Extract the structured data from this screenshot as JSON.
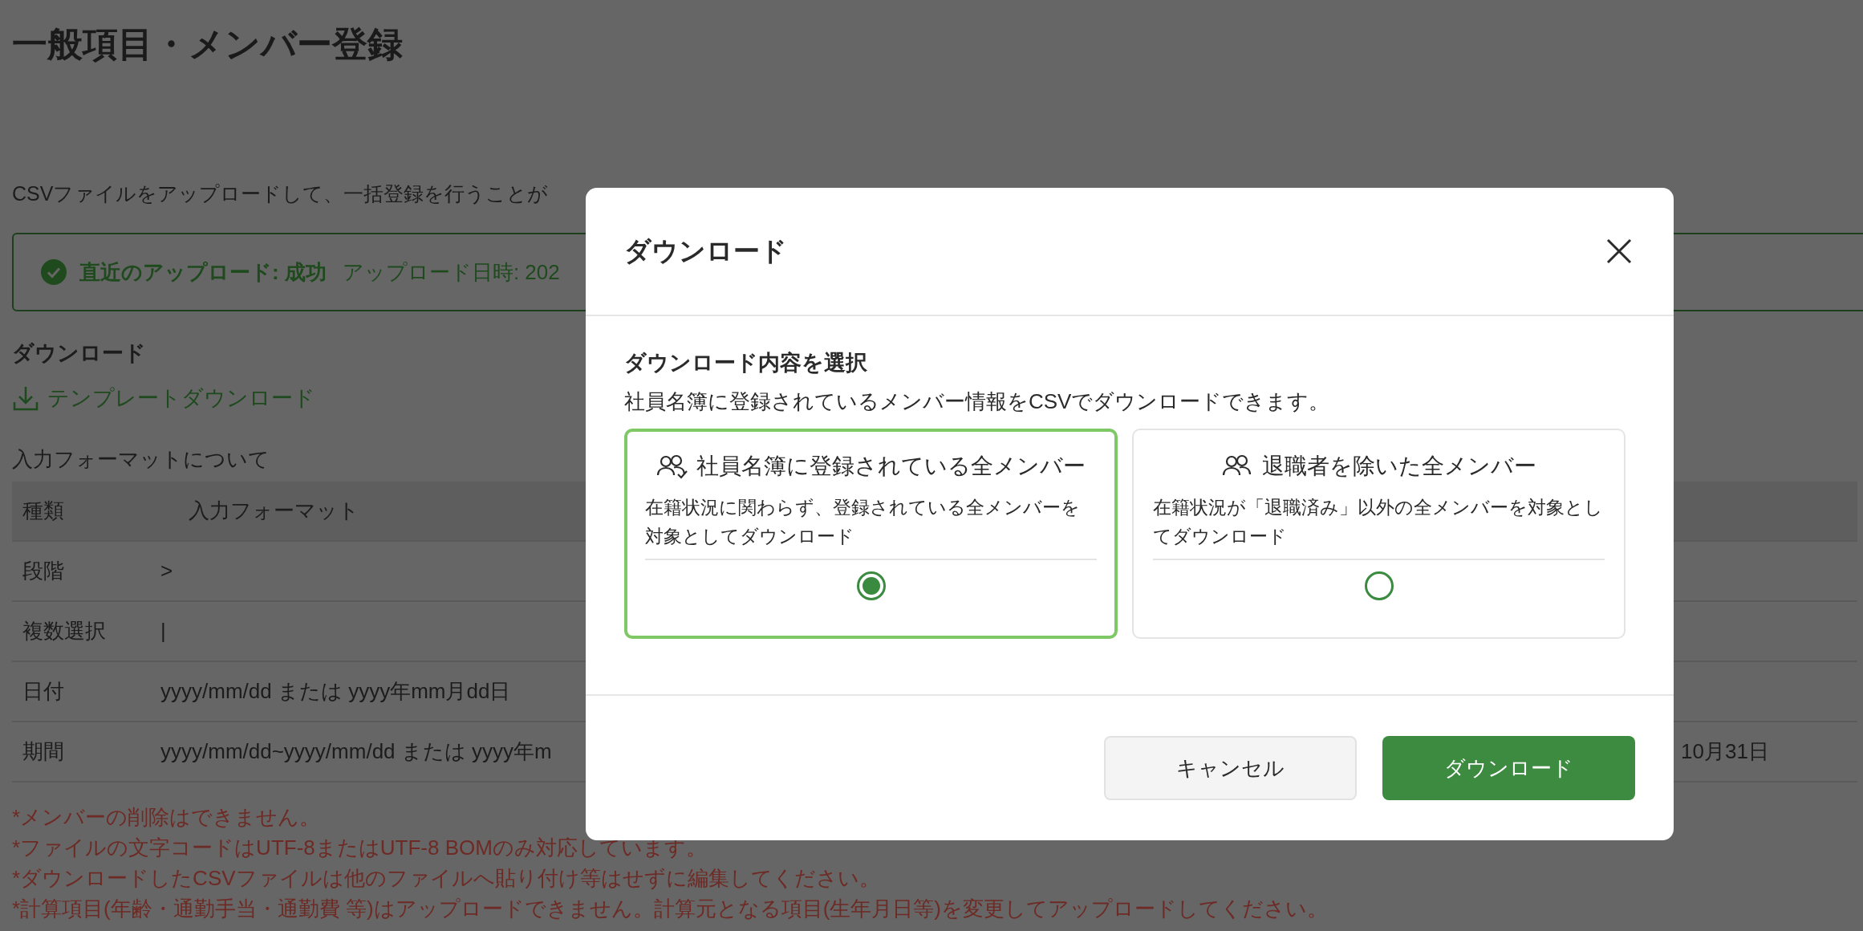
{
  "page": {
    "title": "一般項目・メンバー登録",
    "intro": "CSVファイルをアップロードして、一括登録を行うことが",
    "banner": {
      "status": "直近のアップロード: 成功",
      "detail": "アップロード日時: 202"
    },
    "download_heading": "ダウンロード",
    "template_link": "テンプレートダウンロード",
    "format_heading": "入力フォーマットについて",
    "table": {
      "columns": [
        "種類",
        "入力フォーマット"
      ],
      "rows": [
        {
          "type": "段階",
          "format": ">"
        },
        {
          "type": "複数選択",
          "format": "|"
        },
        {
          "type": "日付",
          "format": "yyyy/mm/dd または yyyy年mm月dd日"
        },
        {
          "type": "期間",
          "format": "yyyy/mm/dd~yyyy/mm/dd または yyyy年m",
          "column_3": "10月31日"
        }
      ]
    },
    "notes": [
      "*メンバーの削除はできません。",
      "*ファイルの文字コードはUTF-8またはUTF-8 BOMのみ対応しています。",
      "*ダウンロードしたCSVファイルは他のファイルへ貼り付け等はせずに編集してください。",
      "*計算項目(年齢・通勤手当・通勤費 等)はアップロードできません。計算元となる項目(生年月日等)を変更してアップロードしてください。"
    ]
  },
  "dialog": {
    "title": "ダウンロード",
    "section_title": "ダウンロード内容を選択",
    "description": "社員名簿に登録されているメンバー情報をCSVでダウンロードできます。",
    "options": [
      {
        "title": "社員名簿に登録されている全メンバー",
        "description": "在籍状況に関わらず、登録されている全メンバーを対象としてダウンロード",
        "selected": true
      },
      {
        "title": "退職者を除いた全メンバー",
        "description": "在籍状況が「退職済み」以外の全メンバーを対象としてダウンロード",
        "selected": false
      }
    ],
    "buttons": [
      {
        "label": "キャンセル",
        "kind": "secondary"
      },
      {
        "label": "ダウンロード",
        "kind": "primary"
      }
    ]
  }
}
